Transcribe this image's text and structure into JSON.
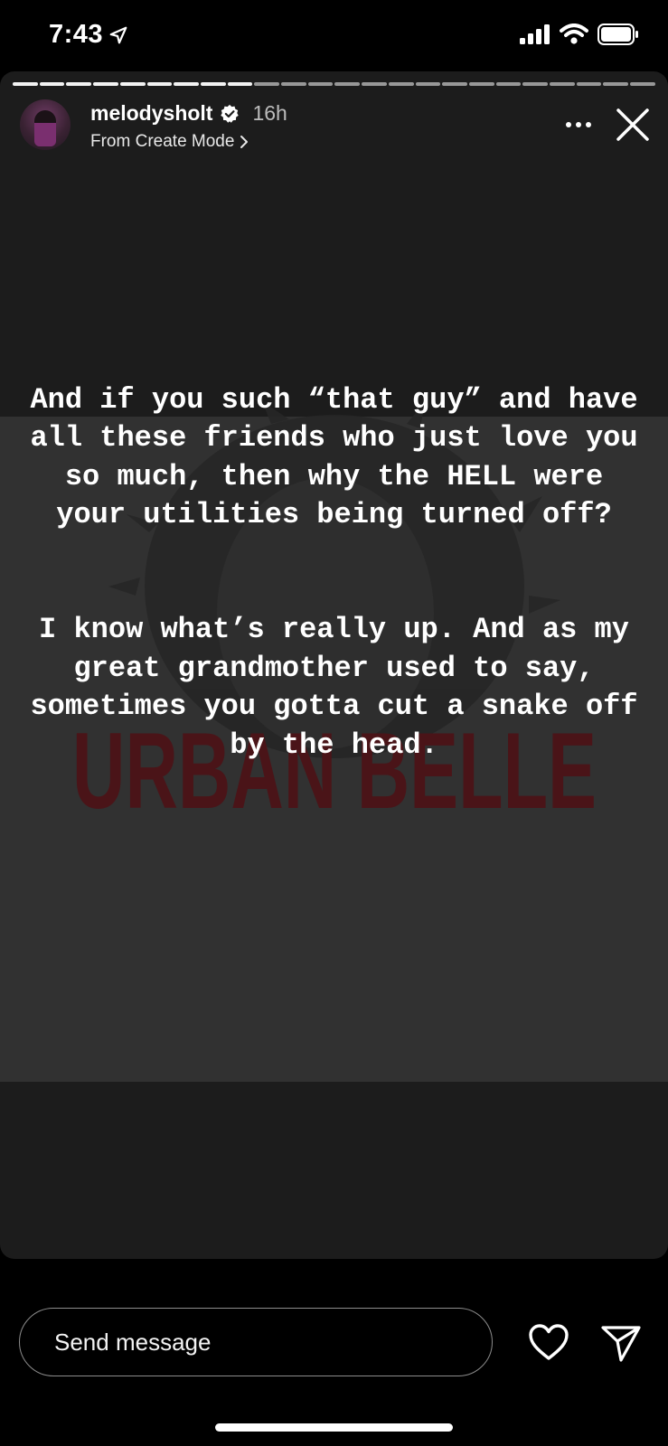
{
  "status_bar": {
    "time": "7:43",
    "icons": [
      "location-arrow-icon",
      "cellular-signal-icon",
      "wifi-icon",
      "battery-icon"
    ]
  },
  "story": {
    "progress_segments_total": 24,
    "progress_segments_viewed": 9,
    "user": {
      "username": "melodysholt",
      "verified": true,
      "time_ago": "16h",
      "subtitle": "From Create Mode"
    },
    "more_label": "···",
    "watermark_text": "URBAN BELLE",
    "text_paragraphs": [
      "And if you such “that guy” and have all these friends who just love you so much, then why the HELL were your utilities being turned off?",
      "I know what’s really up. And as my great grandmother used to say, sometimes you gotta cut a snake off by the head."
    ],
    "colors": {
      "background": "#1c1c1c",
      "panel": "#313131",
      "watermark": "#4a1418"
    }
  },
  "footer": {
    "message_placeholder": "Send message",
    "icons": [
      "heart-icon",
      "send-icon"
    ]
  }
}
